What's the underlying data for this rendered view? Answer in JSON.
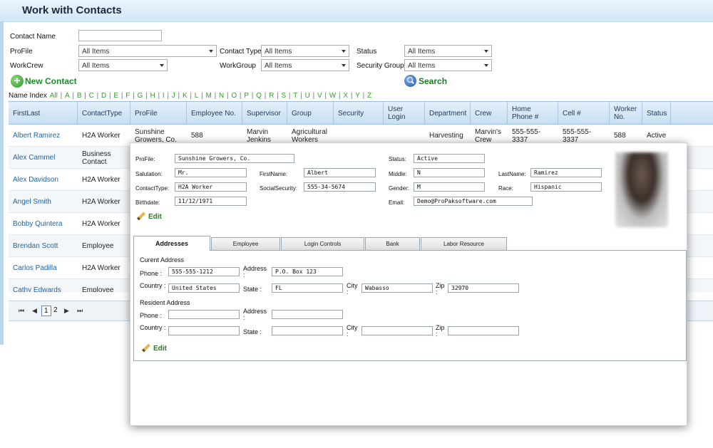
{
  "page": {
    "title": "Work with Contacts"
  },
  "filters": {
    "contact_name_label": "Contact Name",
    "contact_name_value": "",
    "profile_label": "ProFile",
    "profile_value": "All Items",
    "contact_type_label": "Contact Type",
    "contact_type_value": "All Items",
    "status_label": "Status",
    "status_value": "All Items",
    "workcrew_label": "WorkCrew",
    "workcrew_value": "All Items",
    "workgroup_label": "WorkGroup",
    "workgroup_value": "All Items",
    "security_group_label": "Security Group",
    "security_group_value": "All Items"
  },
  "actions": {
    "new_contact": "New Contact",
    "search": "Search"
  },
  "name_index": {
    "label": "Name Index",
    "letters": [
      "All",
      "A",
      "B",
      "C",
      "D",
      "E",
      "F",
      "G",
      "H",
      "I",
      "J",
      "K",
      "L",
      "M",
      "N",
      "O",
      "P",
      "Q",
      "R",
      "S",
      "T",
      "U",
      "V",
      "W",
      "X",
      "Y",
      "Z"
    ]
  },
  "grid": {
    "columns": [
      "FirstLast",
      "ContactType",
      "ProFile",
      "Employee No.",
      "Supervisor",
      "Group",
      "Security",
      "User Login",
      "Department",
      "Crew",
      "Home Phone #",
      "Cell #",
      "Worker No.",
      "Status"
    ],
    "rows": [
      {
        "name": "Albert Ramirez",
        "type": "H2A Worker",
        "profile": "Sunshine Growers, Co.",
        "emp": "588",
        "supervisor": "Marvin Jenkins",
        "group": "Agricultural Workers",
        "security": "",
        "login": "",
        "department": "Harvesting",
        "crew": "Marvin's Crew",
        "home": "555-555-3337",
        "cell": "555-555-3337",
        "worker": "588",
        "status": "Active"
      },
      {
        "name": "Alex Cammel",
        "type": "Business Contact"
      },
      {
        "name": "Alex Davidson",
        "type": "H2A Worker"
      },
      {
        "name": "Angel Smith",
        "type": "H2A Worker"
      },
      {
        "name": "Bobby Quintera",
        "type": "H2A Worker"
      },
      {
        "name": "Brendan Scott",
        "type": "Employee"
      },
      {
        "name": "Carlos Padilla",
        "type": "H2A Worker"
      },
      {
        "name": "Cathy Edwards",
        "type": "Employee"
      }
    ]
  },
  "pager": {
    "pages": [
      "1",
      "2"
    ],
    "current": "1",
    "first": "⏮",
    "prev": "◀",
    "next": "▶",
    "last": "⏭"
  },
  "detail": {
    "profile_label": "ProFile:",
    "profile": "Sunshine Growers, Co.",
    "status_label": "Status:",
    "status": "Active",
    "salutation_label": "Salutation:",
    "salutation": "Mr.",
    "firstname_label": "FirstName:",
    "firstname": "Albert",
    "middle_label": "Middle:",
    "middle": "N",
    "lastname_label": "LastName:",
    "lastname": "Ramirez",
    "contacttype_label": "ContactType:",
    "contacttype": "H2A Worker",
    "social_label": "SocialSecurity:",
    "social": "555-34-5674",
    "gender_label": "Gender:",
    "gender": "M",
    "race_label": "Race:",
    "race": "Hispanic",
    "birthdate_label": "Birthdate:",
    "birthdate": "11/12/1971",
    "email_label": "Email:",
    "email": "Demo@ProPaksoftware.com",
    "edit_label": "Edit",
    "tabs": [
      "Addresses",
      "Employee",
      "Login Controls",
      "Bank",
      "Labor Resource"
    ],
    "addresses": {
      "current_title": "Curent Address",
      "resident_title": "Resident Address",
      "phone_label": "Phone :",
      "address_label": "Address :",
      "country_label": "Country :",
      "state_label": "State :",
      "city_label": "City :",
      "zip_label": "Zip :",
      "current": {
        "phone": "555-555-1212",
        "address": "P.O. Box 123",
        "country": "United States",
        "state": "FL",
        "city": "Wabasso",
        "zip": "32970"
      },
      "resident": {
        "phone": "",
        "address": "",
        "country": "",
        "state": "",
        "city": "",
        "zip": ""
      },
      "edit_label": "Edit"
    }
  }
}
